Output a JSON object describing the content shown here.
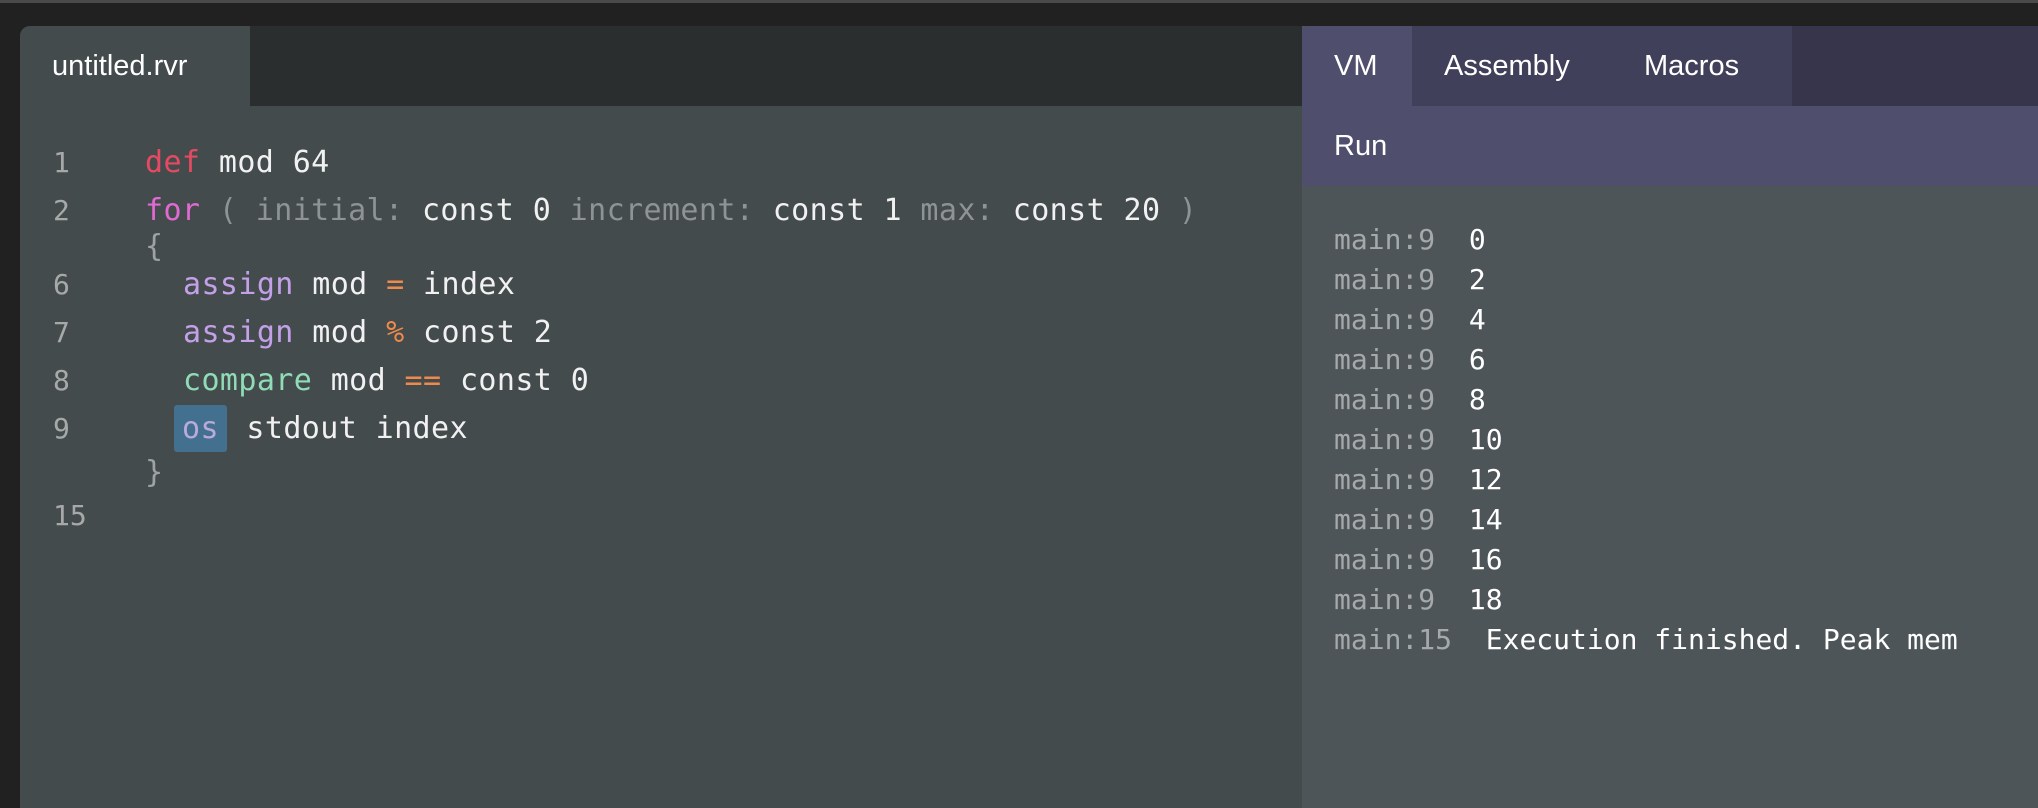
{
  "editor": {
    "file_tab": "untitled.rvr",
    "lines": [
      {
        "num": "1",
        "tokens": [
          {
            "t": "def",
            "c": "kw-def"
          },
          {
            "t": " mod 64",
            "c": ""
          }
        ]
      },
      {
        "num": "2",
        "tokens": [
          {
            "t": "for",
            "c": "kw-for"
          },
          {
            "t": " ( ",
            "c": "dim"
          },
          {
            "t": "initial: ",
            "c": "dim"
          },
          {
            "t": "const 0 ",
            "c": ""
          },
          {
            "t": "increment: ",
            "c": "dim"
          },
          {
            "t": "const 1 ",
            "c": ""
          },
          {
            "t": "max: ",
            "c": "dim"
          },
          {
            "t": "const 20",
            "c": ""
          },
          {
            "t": " )",
            "c": "dim"
          }
        ]
      },
      {
        "num": "",
        "tokens": [
          {
            "t": "{",
            "c": "brace"
          }
        ]
      },
      {
        "num": "6",
        "indent": true,
        "tokens": [
          {
            "t": "assign",
            "c": "kw-assign"
          },
          {
            "t": " mod ",
            "c": ""
          },
          {
            "t": "=",
            "c": "op"
          },
          {
            "t": " index",
            "c": ""
          }
        ]
      },
      {
        "num": "7",
        "indent": true,
        "tokens": [
          {
            "t": "assign",
            "c": "kw-assign"
          },
          {
            "t": " mod ",
            "c": ""
          },
          {
            "t": "%",
            "c": "op"
          },
          {
            "t": " const 2",
            "c": ""
          }
        ]
      },
      {
        "num": "8",
        "indent": true,
        "tokens": [
          {
            "t": "compare",
            "c": "kw-compare"
          },
          {
            "t": " mod ",
            "c": ""
          },
          {
            "t": "==",
            "c": "op"
          },
          {
            "t": " const 0",
            "c": ""
          }
        ]
      },
      {
        "num": "9",
        "indent": true,
        "tokens": [
          {
            "t": "os",
            "c": "kw-os"
          },
          {
            "t": " stdout index",
            "c": ""
          }
        ]
      },
      {
        "num": "",
        "tokens": [
          {
            "t": "}",
            "c": "brace"
          }
        ]
      },
      {
        "num": "15",
        "tokens": []
      }
    ]
  },
  "vm_panel": {
    "tabs": [
      {
        "label": "VM",
        "active": true
      },
      {
        "label": "Assembly",
        "active": false
      },
      {
        "label": "Macros",
        "active": false
      }
    ],
    "run_label": "Run",
    "output": [
      {
        "loc": "main:9",
        "val": "0"
      },
      {
        "loc": "main:9",
        "val": "2"
      },
      {
        "loc": "main:9",
        "val": "4"
      },
      {
        "loc": "main:9",
        "val": "6"
      },
      {
        "loc": "main:9",
        "val": "8"
      },
      {
        "loc": "main:9",
        "val": "10"
      },
      {
        "loc": "main:9",
        "val": "12"
      },
      {
        "loc": "main:9",
        "val": "14"
      },
      {
        "loc": "main:9",
        "val": "16"
      },
      {
        "loc": "main:9",
        "val": "18"
      },
      {
        "loc": "main:15",
        "val": "Execution finished. Peak mem"
      }
    ]
  },
  "colors": {
    "keyword_def": "#e64a62",
    "keyword_for": "#e06ad1",
    "keyword_assign": "#c3a1e8",
    "keyword_compare": "#8fdcb6",
    "operator": "#f08a4b",
    "highlight": "#44708f",
    "vm_accent": "#4f4e6c"
  }
}
